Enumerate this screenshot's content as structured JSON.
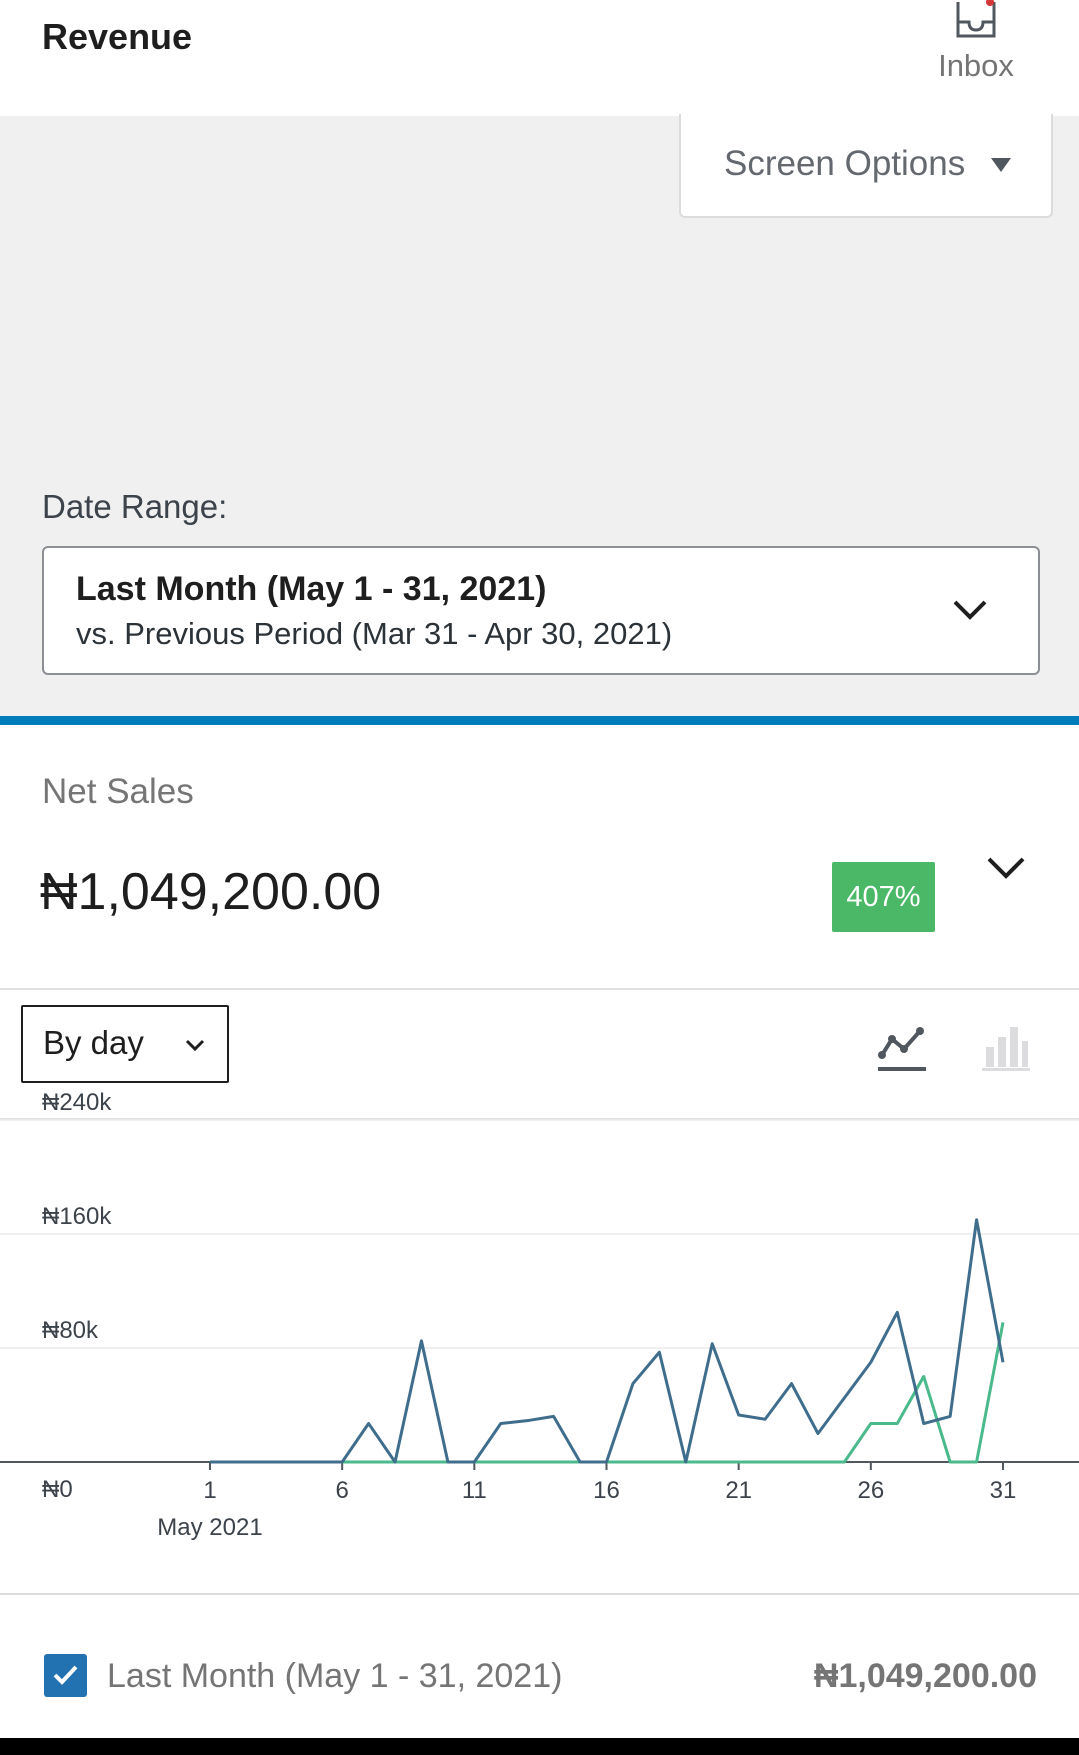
{
  "header": {
    "title": "Revenue",
    "inbox_label": "Inbox"
  },
  "screen_options": {
    "label": "Screen Options"
  },
  "date_range": {
    "label": "Date Range:",
    "primary": "Last Month (May 1 - 31, 2021)",
    "secondary": "vs. Previous Period (Mar 31 - Apr 30, 2021)"
  },
  "summary": {
    "label": "Net Sales",
    "value": "₦1,049,200.00",
    "delta": "407%"
  },
  "chart_controls": {
    "interval": "By day",
    "chart_type_icons": [
      "line-chart-icon",
      "bar-chart-icon"
    ],
    "active_chart_type": "line"
  },
  "chart_data": {
    "type": "line",
    "x": [
      1,
      2,
      3,
      4,
      5,
      6,
      7,
      8,
      9,
      10,
      11,
      12,
      13,
      14,
      15,
      16,
      17,
      18,
      19,
      20,
      21,
      22,
      23,
      24,
      25,
      26,
      27,
      28,
      29,
      30,
      31
    ],
    "x_tick_labels": [
      "1",
      "6",
      "11",
      "16",
      "21",
      "26",
      "31"
    ],
    "x_tick_values": [
      1,
      6,
      11,
      16,
      21,
      26,
      31
    ],
    "x_sublabel": "May 2021",
    "y_tick_labels": [
      "₦0",
      "₦80k",
      "₦160k",
      "₦240k"
    ],
    "y_tick_values": [
      0,
      80000,
      160000,
      240000
    ],
    "ylim": [
      0,
      240000
    ],
    "grid": true,
    "series": [
      {
        "color": "#3f6e8c",
        "values": [
          0,
          0,
          0,
          0,
          0,
          0,
          27000,
          0,
          85000,
          0,
          0,
          27000,
          29000,
          32000,
          0,
          0,
          55000,
          77000,
          0,
          83000,
          33000,
          30000,
          55000,
          20000,
          45000,
          70000,
          105000,
          27000,
          32000,
          170000,
          70000
        ]
      },
      {
        "color": "#4ab98b",
        "values": [
          0,
          0,
          0,
          0,
          0,
          0,
          0,
          0,
          0,
          0,
          0,
          0,
          0,
          0,
          0,
          0,
          0,
          0,
          0,
          0,
          0,
          0,
          0,
          0,
          0,
          27000,
          27000,
          60000,
          0,
          0,
          98000
        ]
      }
    ]
  },
  "legend": {
    "label": "Last Month (May 1 - 31, 2021)",
    "value": "₦1,049,200.00",
    "checked": true
  }
}
